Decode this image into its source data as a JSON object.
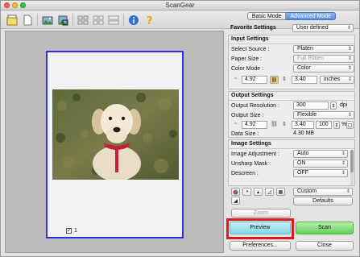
{
  "window": {
    "title": "ScanGear"
  },
  "toolbar": {
    "icons": [
      "open-document-icon",
      "new-document-icon",
      "photo-auto-crop-icon",
      "photo-crop-icon",
      "thumbnail-icon",
      "multi-crop-icon",
      "info-icon",
      "help-icon"
    ]
  },
  "preview": {
    "page_number": "1",
    "checkbox_checked": true
  },
  "tabs": {
    "basic": "Basic Mode",
    "advanced": "Advanced Mode",
    "active": "advanced"
  },
  "favorite": {
    "label": "Favorite Settings",
    "value": "User defined"
  },
  "input_settings": {
    "title": "Input Settings",
    "select_source_label": "Select Source :",
    "select_source_value": "Platen",
    "paper_size_label": "Paper Size :",
    "paper_size_value": "Full Platen",
    "color_mode_label": "Color Mode :",
    "color_mode_value": "Color",
    "width": "4.92",
    "height": "3.40",
    "unit": "inches"
  },
  "output_settings": {
    "title": "Output Settings",
    "resolution_label": "Output Resolution :",
    "resolution_value": "300",
    "resolution_unit": "dpi",
    "output_size_label": "Output Size :",
    "output_size_value": "Flexible",
    "width": "4.92",
    "height": "3.40",
    "scale": "100",
    "scale_unit": "%",
    "data_size_label": "Data Size :",
    "data_size_value": "4.30 MB"
  },
  "image_settings": {
    "title": "Image Settings",
    "adjustment_label": "Image Adjustment :",
    "adjustment_value": "Auto",
    "unsharp_label": "Unsharp Mask :",
    "unsharp_value": "ON",
    "descreen_label": "Descreen :",
    "descreen_value": "OFF",
    "preset_value": "Custom",
    "defaults_label": "Defaults"
  },
  "buttons": {
    "zoom": "Zoom",
    "preview": "Preview",
    "scan": "Scan",
    "preferences": "Preferences...",
    "close": "Close"
  },
  "colors": {
    "selection_frame": "#2e2ee6",
    "highlight": "#e01a1a",
    "preview_button": "#7fd7e6",
    "scan_button": "#62cf57"
  }
}
